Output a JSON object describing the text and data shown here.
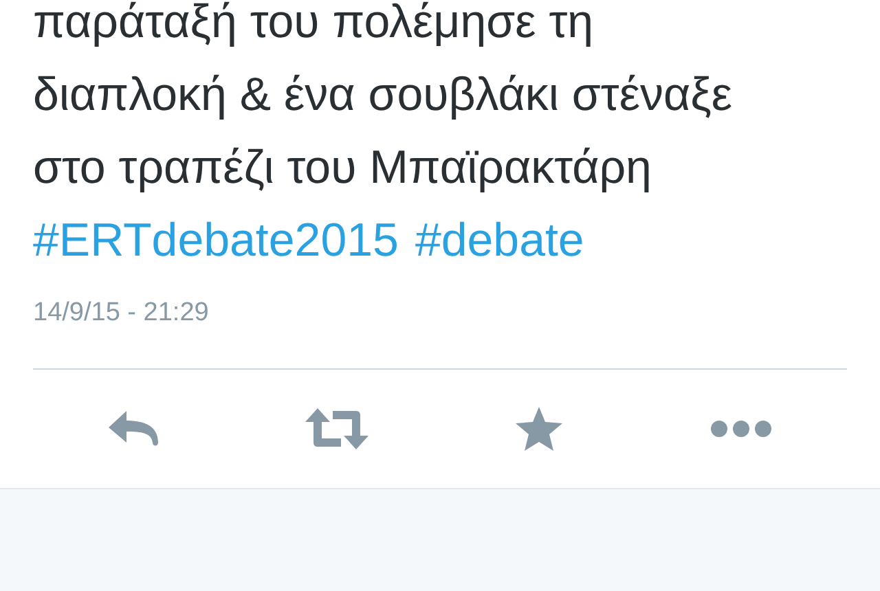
{
  "tweet": {
    "text_lines": [
      "παράταξή του πολέμησε τη",
      "διαπλοκή & ένα σουβλάκι στέναξε",
      "στο τραπέζι του Μπαϊρακτάρη"
    ],
    "hashtags": [
      "#ERTdebate2015",
      "#debate"
    ],
    "timestamp": "14/9/15 - 21:29",
    "actions": [
      {
        "kind": "reply"
      },
      {
        "kind": "retweet"
      },
      {
        "kind": "favorite"
      },
      {
        "kind": "more"
      }
    ]
  }
}
